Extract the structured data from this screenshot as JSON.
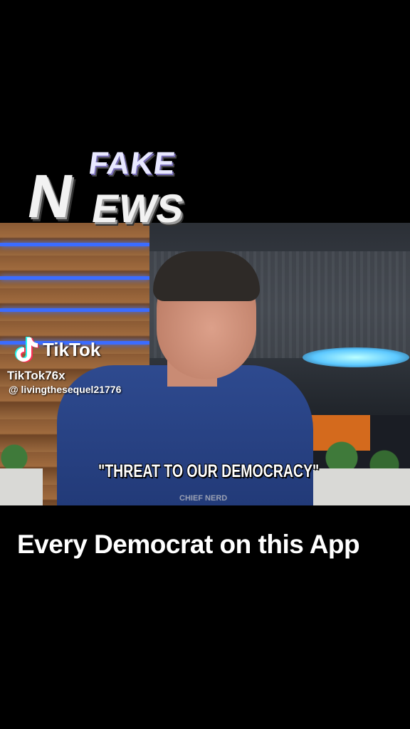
{
  "video": {
    "overlay_title_top": "FAKE",
    "overlay_title_letter": "N",
    "overlay_title_rest": "EWS",
    "subtitle": "\"THREAT TO OUR DEMOCRACY\"",
    "corner_logo": "CHIEF NERD"
  },
  "watermark": {
    "brand": "TikTok",
    "handle_garbled": "TikTok76x",
    "username": "@ livingthesequel21776"
  },
  "caption": "Every Democrat on this App",
  "colors": {
    "background": "#000000",
    "led_accent": "#3b6cff",
    "shirt": "#2e4a8f"
  },
  "icons": [
    "tiktok-icon"
  ]
}
